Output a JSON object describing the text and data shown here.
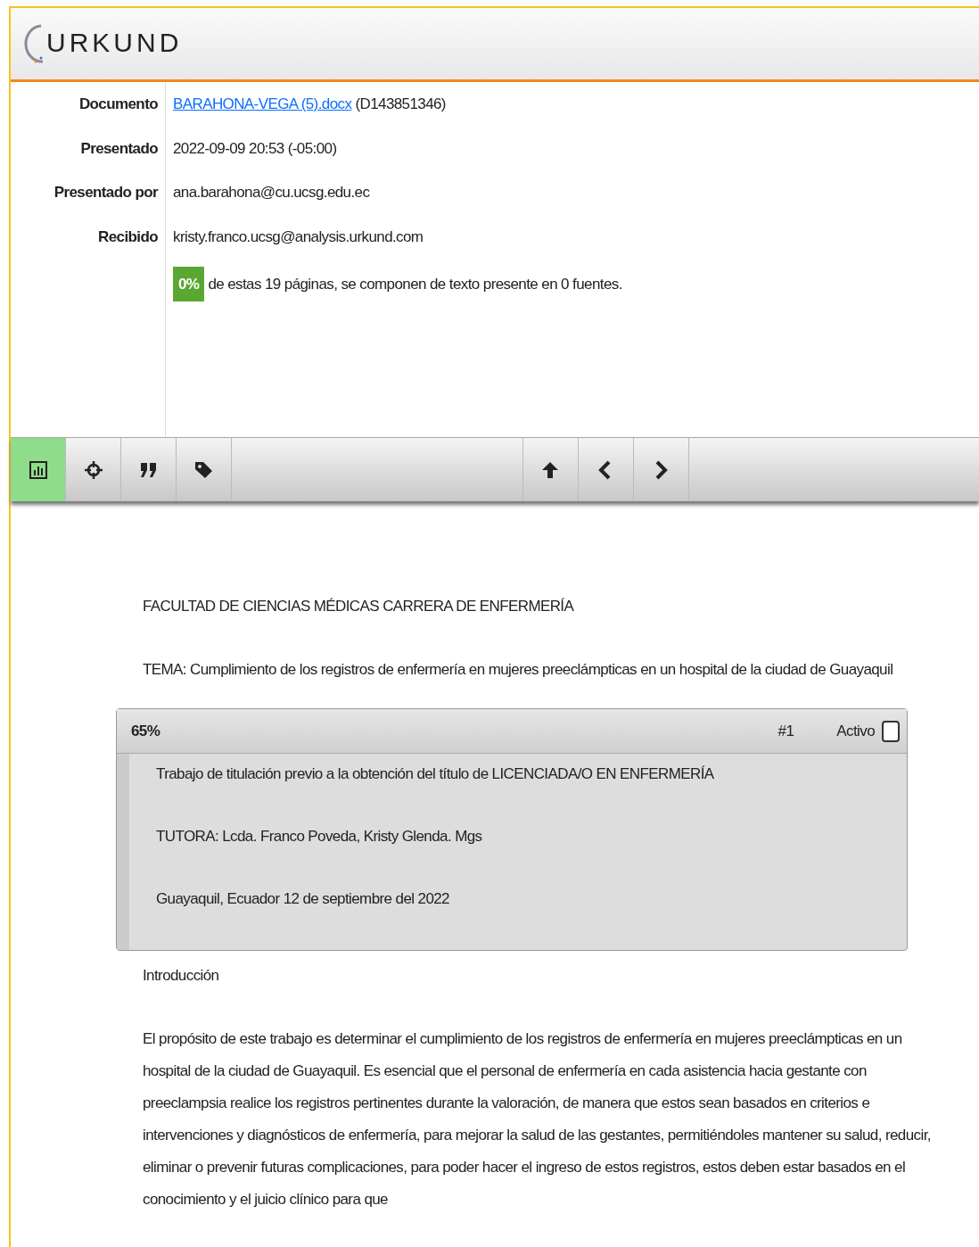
{
  "logo": {
    "text": "URKUND"
  },
  "meta": [
    {
      "label": "Documento",
      "link": "BARAHONA-VEGA (5).docx",
      "value": "(D143851346)"
    },
    {
      "label": "Presentado",
      "value": "2022-09-09 20:53 (-05:00)"
    },
    {
      "label": "Presentado por",
      "value": "ana.barahona@cu.ucsg.edu.ec"
    },
    {
      "label": "Recibido",
      "value": "kristy.franco.ucsg@analysis.urkund.com"
    }
  ],
  "summary": {
    "percent": "0%",
    "text": "de estas 19 páginas, se componen de texto presente en 0 fuentes."
  },
  "toolbar_left": [
    {
      "kind": "chart",
      "selected": true
    },
    {
      "kind": "target",
      "selected": false
    },
    {
      "kind": "quote",
      "selected": false
    },
    {
      "kind": "tags",
      "selected": false
    }
  ],
  "toolbar_right": [
    {
      "kind": "up",
      "selected": false
    },
    {
      "kind": "prev",
      "selected": false
    },
    {
      "kind": "next",
      "selected": false
    }
  ],
  "document": [
    {
      "kind": "para",
      "text": "FACULTAD DE CIENCIAS MÉDICAS CARRERA DE ENFERMERÍA"
    },
    {
      "kind": "para",
      "text": "TEMA: Cumplimiento de los registros de enfermería en mujeres preeclámpticas en un hospital de la ciudad de Guayaquil"
    },
    {
      "kind": "match",
      "percent": "65%",
      "number": "#1",
      "active_label": "Activo",
      "checked": false,
      "lines": [
        "Trabajo de titulación previo a la obtención del título de LICENCIADA/O EN ENFERMERÍA",
        "TUTORA: Lcda. Franco Poveda, Kristy Glenda. Mgs",
        "Guayaquil, Ecuador 12 de septiembre del 2022"
      ]
    },
    {
      "kind": "para",
      "text": "Introducción"
    },
    {
      "kind": "para",
      "text": "El propósito de este trabajo es determinar el cumplimiento de los registros de enfermería en mujeres preeclámpticas en un hospital de la ciudad de Guayaquil. Es esencial que el personal de enfermería en cada asistencia hacia gestante con preeclampsia realice los registros pertinentes durante la valoración, de manera que estos sean basados en criterios e intervenciones y diagnósticos de enfermería, para mejorar la salud de las gestantes, permitiéndoles mantener su salud, reducir, eliminar o prevenir futuras complicaciones, para poder hacer el ingreso de estos registros, estos deben estar basados en el conocimiento y el juicio clínico para que"
    }
  ]
}
